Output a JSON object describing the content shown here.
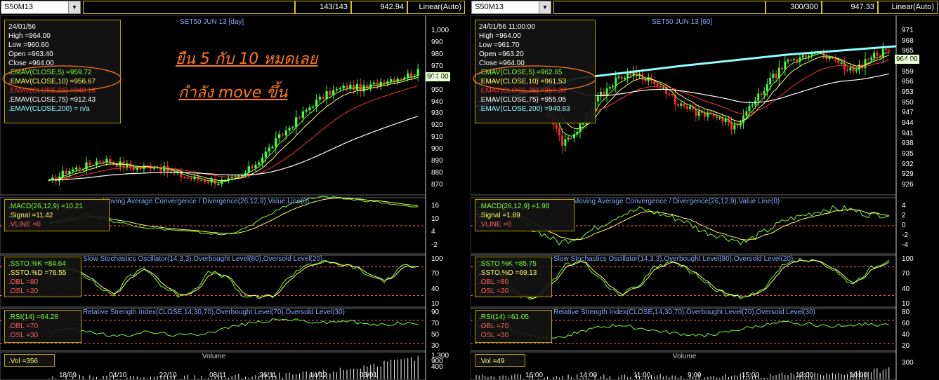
{
  "left": {
    "symbol": "S50M13",
    "bars_info": "143/143",
    "last_value": "942.94",
    "scale_mode": "Linear(Auto)",
    "chart_title": "SET50 JUN 13   [day]",
    "price_tag": "964.00",
    "ohlc": {
      "date": "24/01/56",
      "high": "High  =964.00",
      "low": "Low   =960.60",
      "open": "Open  =963.40",
      "close": "Close  =964.00"
    },
    "ema": [
      {
        "label": ".EMAV(CLOSE,5)   =959.72",
        "color": "#7cff3c"
      },
      {
        "label": ".EMAV(CLOSE,10)   =956.67",
        "color": "#ffff66"
      },
      {
        "label": ".EMAV(CLOSE,25)   =948.16",
        "color": "#ff3030"
      },
      {
        "label": ".EMAV(CLOSE,75)   =912.43",
        "color": "#ffffff"
      },
      {
        "label": ".EMAV(CLOSE,200)   = n/a",
        "color": "#8fffff"
      }
    ],
    "annotation_1": "ยืน 5 กับ 10 หมดเลย",
    "annotation_2": "กำลัง move ขึ้น",
    "price_axis": [
      "1,000",
      "990",
      "980",
      "970",
      "960",
      "950",
      "940",
      "930",
      "920",
      "910",
      "900",
      "890",
      "880",
      "870"
    ],
    "macd_title": "Moving Average Convergence / Divergence(26,12,9),Value Line(0)",
    "macd_legend": [
      ".MACD(26,12,9)   =10.21",
      ".Signal   =11.42",
      ".VLINE   =0"
    ],
    "macd_axis": [
      "16",
      "10",
      "4",
      "-2"
    ],
    "ssto_title": "Slow Stochastics Oscillator(14,3,3),Overbought Level(80),Oversold Level(20)",
    "ssto_legend": [
      ".SSTO.%K   =84.64",
      ".SSTO.%D   =76.55",
      ".OBL   =80",
      ".OSL   =20"
    ],
    "ssto_axis": [
      "100",
      "70",
      "40",
      "10"
    ],
    "rsi_title": "Relative Strength Index(CLOSE,14,30,70),Overbought Level(70),Oversold Level(30)",
    "rsi_legend": [
      ".RSI(14)   =64.28",
      ".OBL   =70",
      ".OSL   =30"
    ],
    "rsi_axis": [
      "90",
      "70",
      "50",
      "30"
    ],
    "vol_title": "Volume",
    "vol_legend": ".Vol   =356",
    "vol_axis": [
      "1,300",
      "900",
      "400"
    ],
    "x_axis": [
      "18/09",
      "04/10",
      "22/10",
      "08/11",
      "26/11",
      "14/12",
      "03/01"
    ]
  },
  "right": {
    "symbol": "S50M13",
    "bars_info": "300/300",
    "last_value": "947.33",
    "scale_mode": "Linear(Auto)",
    "chart_title": "SET50 JUN 13   [60]",
    "price_tag": "964.00",
    "ohlc": {
      "date": "24/01/56 11:00:00",
      "high": "High  =964.00",
      "low": "Low   =961.70",
      "open": "Open  =963.20",
      "close": "Close  =964.00"
    },
    "ema": [
      {
        "label": ".EMAV(CLOSE,5)   =962.65",
        "color": "#7cff3c"
      },
      {
        "label": ".EMAV(CLOSE,10)   =961.53",
        "color": "#ffff66"
      },
      {
        "label": ".EMAV(CLOSE,25)   =959.38",
        "color": "#ff3030"
      },
      {
        "label": ".EMAV(CLOSE,75)   =955.05",
        "color": "#ffffff"
      },
      {
        "label": ".EMAV(CLOSE,200)   =940.83",
        "color": "#8fffff"
      }
    ],
    "price_axis": [
      "971",
      "968",
      "965",
      "962",
      "959",
      "956",
      "953",
      "950",
      "947",
      "944",
      "941",
      "938",
      "935",
      "932",
      "929",
      "926"
    ],
    "macd_title": "Moving Average Convergence / Divergence(26,12,9),Value Line(0)",
    "macd_legend": [
      ".MACD(26,12,9)   =1.98",
      ".Signal   =1.89",
      ".VLINE   =0"
    ],
    "macd_axis": [
      "4",
      "2",
      "0",
      "-2",
      "-4"
    ],
    "ssto_title": "Slow Stochastics Oscillator(14,3,3),Overbought Level(80),Oversold Level(20)",
    "ssto_legend": [
      ".SSTO.%K   =85.75",
      ".SSTO.%D   =69.13",
      ".OBL   =80",
      ".OSL   =20"
    ],
    "ssto_axis": [
      "100",
      "70",
      "40",
      "10"
    ],
    "rsi_title": "Relative Strength Index(CLOSE,14,30,70),Overbought Level(70),Oversold Level(30)",
    "rsi_legend": [
      ".RSI(14)   =61.05",
      ".OBL   =70",
      ".OSL   =30"
    ],
    "rsi_axis": [
      "80",
      "60",
      "40",
      "20"
    ],
    "vol_title": "Volume",
    "vol_legend": ".Vol   =49",
    "vol_axis": [
      "300"
    ],
    "x_axis": [
      "16:00",
      "14:00",
      "11:00",
      "9:00",
      "15:00",
      "12:00",
      "10:00"
    ]
  }
}
